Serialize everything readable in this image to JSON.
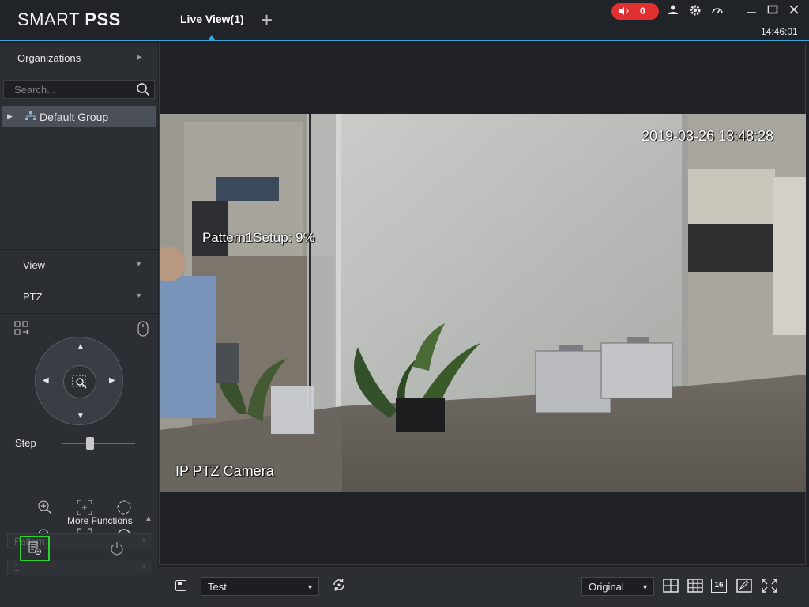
{
  "app": {
    "brand_light": "SMART ",
    "brand_bold": "PSS"
  },
  "tabs": [
    {
      "label": "Live View(1)"
    }
  ],
  "titlebar": {
    "alarm_count": "0",
    "clock": "14:46:01",
    "alarm_color": "#e23030",
    "accent": "#36a3d9"
  },
  "sidebar": {
    "organizations_label": "Organizations",
    "search_placeholder": "Search...",
    "tree": [
      {
        "label": "Default Group"
      }
    ],
    "view_label": "View",
    "ptz_label": "PTZ",
    "step_label": "Step",
    "step_value": 0.37,
    "more_functions_label": "More Functions",
    "function_select": "Pattern",
    "function_number": "1"
  },
  "video": {
    "timestamp": "2019-03-26 13:48:28",
    "status_text": "Pattern1Setup: 9%",
    "camera_name": "IP PTZ Camera"
  },
  "bottombar": {
    "view_select": "Test",
    "stream_select": "Original",
    "layout_16_label": "16"
  },
  "icons": [
    "speaker-icon",
    "user-icon",
    "gear-icon",
    "speedometer-icon",
    "minimize-icon",
    "maximize-icon",
    "close-icon",
    "search-icon",
    "org-tree-icon",
    "grid-icon",
    "mouse-icon",
    "zoom-in-icon",
    "zoom-out-icon",
    "focus-near-icon",
    "focus-far-icon",
    "iris-open-icon",
    "iris-close-icon",
    "save-layout-icon",
    "power-icon",
    "refresh-icon",
    "layout-4-icon",
    "layout-9-icon",
    "edit-icon",
    "fullscreen-icon"
  ]
}
